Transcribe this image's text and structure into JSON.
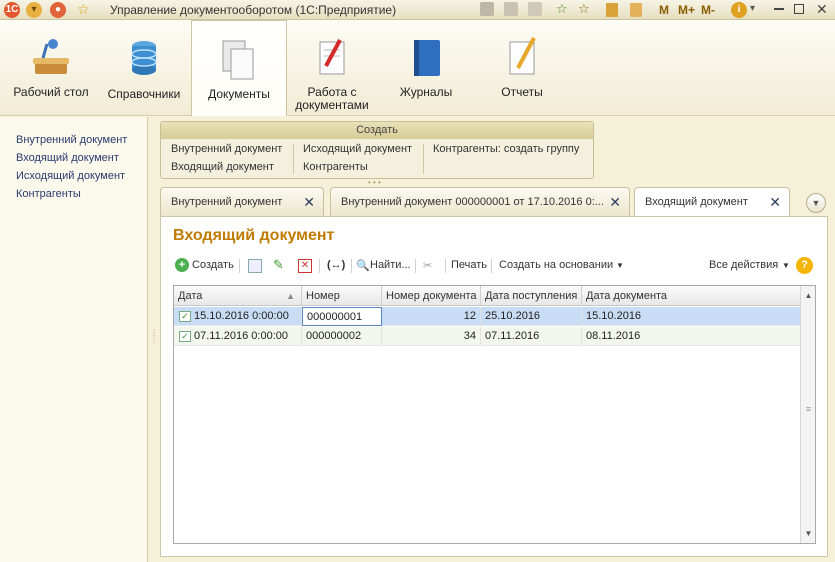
{
  "app": {
    "title": "Управление документооборотом  (1С:Предприятие)",
    "logo": "1C",
    "title_buttons": [
      "M",
      "M+",
      "M-"
    ]
  },
  "sections": [
    {
      "label": "Рабочий стол",
      "icon": "desk-icon"
    },
    {
      "label": "Справочники",
      "icon": "database-icon"
    },
    {
      "label": "Документы",
      "icon": "documents-icon",
      "active": true
    },
    {
      "label": "Работа с документами",
      "icon": "document-edit-icon"
    },
    {
      "label": "Журналы",
      "icon": "journal-book-icon"
    },
    {
      "label": "Отчеты",
      "icon": "report-icon"
    }
  ],
  "nav": {
    "links": [
      "Внутренний документ",
      "Входящий документ",
      "Исходящий документ",
      "Контрагенты"
    ]
  },
  "create_panel": {
    "title": "Создать",
    "col1": [
      "Внутренний документ",
      "Входящий документ"
    ],
    "col2": [
      "Исходящий документ",
      "Контрагенты"
    ],
    "col3": [
      "Контрагенты: создать группу"
    ]
  },
  "tabs": [
    {
      "label": "Внутренний документ"
    },
    {
      "label": "Внутренний документ 000000001 от 17.10.2016 0:..."
    },
    {
      "label": "Входящий документ",
      "active": true
    }
  ],
  "form": {
    "title": "Входящий документ",
    "commands": {
      "create": "Создать",
      "find": "Найти...",
      "print": "Печать",
      "create_based": "Создать на основании",
      "all_actions": "Все действия",
      "help": "?"
    },
    "table": {
      "columns": [
        "Дата",
        "Номер",
        "Номер документа",
        "Дата поступления",
        "Дата документа"
      ],
      "rows": [
        {
          "date": "15.10.2016 0:00:00",
          "number": "000000001",
          "doc_number": "12",
          "received": "25.10.2016",
          "doc_date": "15.10.2016"
        },
        {
          "date": "07.11.2016 0:00:00",
          "number": "000000002",
          "doc_number": "34",
          "received": "07.11.2016",
          "doc_date": "08.11.2016"
        }
      ]
    }
  },
  "colors": {
    "accent": "#c07c00",
    "selected_row": "#c9dcf5",
    "link": "#2a3b6e"
  }
}
